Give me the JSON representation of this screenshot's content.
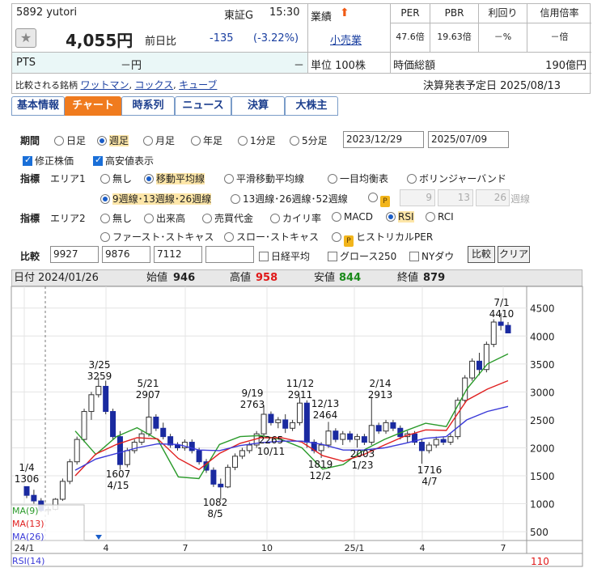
{
  "stock": {
    "code_name": "5892 yutori",
    "market": "東証G",
    "time": "15:30",
    "price": "4,055円",
    "prev_label": "前日比",
    "change": "-135",
    "change_pct": "(-3.22%)",
    "pts_label": "PTS",
    "pts_value": "－円",
    "pts_change": "－",
    "gyoseki_label": "業績",
    "sector": "小売業",
    "unit": "単位 100株",
    "compare_label": "比較される銘柄",
    "compare_list": [
      "ワットマン",
      "コックス",
      "キューブ"
    ],
    "settlement": "決算発表予定日 2025/08/13"
  },
  "metrics": {
    "headers": [
      "PER",
      "PBR",
      "利回り",
      "信用倍率"
    ],
    "values": [
      "47.6倍",
      "19.63倍",
      "－%",
      "－倍"
    ],
    "mcap_label": "時価総額",
    "mcap_value": "190億円"
  },
  "tabs": [
    "基本情報",
    "チャート",
    "時系列",
    "ニュース",
    "決算",
    "大株主"
  ],
  "controls": {
    "period_label": "期間",
    "period_options": [
      "日足",
      "週足",
      "月足",
      "年足",
      "1分足",
      "5分足"
    ],
    "date_from": "2023/12/29",
    "date_to": "2025/07/09",
    "adjusted_label": "修正株価",
    "highlow_label": "高安値表示",
    "indicator_label": "指標",
    "area1_label": "エリア1",
    "area1_options": [
      "無し",
      "移動平均線",
      "平滑移動平均線",
      "一目均衡表",
      "ボリンジャーバンド"
    ],
    "ma_options": [
      "9週線･13週線･26週線",
      "13週線･26週線･52週線"
    ],
    "ma_custom": [
      "9",
      "13",
      "26"
    ],
    "ma_unit": "週線",
    "area2_label": "エリア2",
    "area2_options": [
      "無し",
      "出来高",
      "売買代金",
      "カイリ率",
      "MACD",
      "RSI",
      "RCI"
    ],
    "area2_row2": [
      "ファースト･ストキャス",
      "スロー･ストキャス",
      "ヒストリカルPER"
    ],
    "compare_label": "比較",
    "compare_codes": [
      "9927",
      "9876",
      "7112",
      ""
    ],
    "compare_checks": [
      "日経平均",
      "グロース250",
      "NYダウ"
    ],
    "compare_btn": "比較",
    "clear_btn": "クリア"
  },
  "infobar": {
    "date_label": "日付",
    "date": "2024/01/26",
    "open_label": "始値",
    "open": "946",
    "high_label": "高値",
    "high": "958",
    "low_label": "安値",
    "low": "844",
    "close_label": "終値",
    "close": "879"
  },
  "chart_data": {
    "type": "candlestick",
    "ylim": [
      400,
      4800
    ],
    "yticks": [
      500,
      1000,
      1500,
      2000,
      2500,
      3000,
      3500,
      4000,
      4500
    ],
    "xticks": [
      "24/1",
      "4",
      "7",
      "10",
      "25/1",
      "4",
      "7"
    ],
    "candles": [
      [
        1306,
        1306,
        1100,
        1150
      ],
      [
        1150,
        1250,
        1000,
        1050
      ],
      [
        1050,
        1100,
        850,
        879
      ],
      [
        879,
        950,
        800,
        900
      ],
      [
        900,
        1100,
        880,
        1080
      ],
      [
        1080,
        1450,
        1050,
        1400
      ],
      [
        1400,
        1800,
        1350,
        1750
      ],
      [
        1750,
        2200,
        1700,
        2150
      ],
      [
        2150,
        2700,
        2100,
        2650
      ],
      [
        2650,
        3000,
        2500,
        2950
      ],
      [
        2950,
        3259,
        2900,
        3100
      ],
      [
        3100,
        3200,
        2600,
        2650
      ],
      [
        2650,
        2700,
        2150,
        2200
      ],
      [
        2200,
        2300,
        1607,
        1700
      ],
      [
        1700,
        2000,
        1650,
        1950
      ],
      [
        1950,
        2150,
        1900,
        2100
      ],
      [
        2100,
        2300,
        2050,
        2250
      ],
      [
        2250,
        2907,
        2200,
        2550
      ],
      [
        2550,
        2600,
        2300,
        2350
      ],
      [
        2350,
        2450,
        2150,
        2200
      ],
      [
        2200,
        2250,
        2000,
        2050
      ],
      [
        2050,
        2100,
        1950,
        2000
      ],
      [
        2000,
        2150,
        1950,
        2100
      ],
      [
        2100,
        2150,
        1900,
        1950
      ],
      [
        1950,
        2000,
        1700,
        1750
      ],
      [
        1750,
        1800,
        1550,
        1600
      ],
      [
        1600,
        1650,
        1300,
        1350
      ],
      [
        1350,
        1450,
        1082,
        1300
      ],
      [
        1300,
        1700,
        1280,
        1650
      ],
      [
        1650,
        1900,
        1600,
        1850
      ],
      [
        1850,
        2000,
        1800,
        1950
      ],
      [
        1950,
        2100,
        1900,
        2050
      ],
      [
        2050,
        2300,
        2000,
        2250
      ],
      [
        2250,
        2763,
        2200,
        2600
      ],
      [
        2600,
        2650,
        2400,
        2450
      ],
      [
        2450,
        2550,
        2350,
        2500
      ],
      [
        2500,
        2600,
        2265,
        2350
      ],
      [
        2350,
        2500,
        2300,
        2450
      ],
      [
        2450,
        2911,
        2400,
        2800
      ],
      [
        2800,
        2850,
        2000,
        2100
      ],
      [
        2100,
        2150,
        1900,
        1950
      ],
      [
        1950,
        2100,
        1819,
        2050
      ],
      [
        2050,
        2464,
        2000,
        2300
      ],
      [
        2300,
        2350,
        2100,
        2150
      ],
      [
        2150,
        2300,
        2050,
        2250
      ],
      [
        2250,
        2300,
        2100,
        2150
      ],
      [
        2150,
        2250,
        2003,
        2200
      ],
      [
        2200,
        2250,
        2050,
        2100
      ],
      [
        2100,
        2913,
        2050,
        2400
      ],
      [
        2400,
        2450,
        2250,
        2300
      ],
      [
        2300,
        2500,
        2250,
        2450
      ],
      [
        2450,
        2500,
        2300,
        2350
      ],
      [
        2350,
        2400,
        2150,
        2200
      ],
      [
        2200,
        2300,
        2100,
        2250
      ],
      [
        2250,
        2300,
        2050,
        2100
      ],
      [
        2100,
        2150,
        1716,
        1950
      ],
      [
        1950,
        2100,
        1900,
        2050
      ],
      [
        2050,
        2200,
        2000,
        2150
      ],
      [
        2150,
        2200,
        2050,
        2100
      ],
      [
        2100,
        2250,
        2050,
        2200
      ],
      [
        2200,
        2900,
        2150,
        2850
      ],
      [
        2850,
        3300,
        2800,
        3250
      ],
      [
        3250,
        3600,
        3200,
        3550
      ],
      [
        3550,
        3700,
        3300,
        3400
      ],
      [
        3400,
        3900,
        3350,
        3850
      ],
      [
        3850,
        4300,
        3800,
        4250
      ],
      [
        4250,
        4410,
        4100,
        4190
      ],
      [
        4190,
        4250,
        4050,
        4055
      ]
    ],
    "ma": [
      {
        "name": "MA(9)",
        "color": "#2a9a2a",
        "values": [
          2300,
          1880,
          2200,
          2360,
          2150,
          1480,
          1450,
          2060,
          2200,
          2220,
          2150,
          2000,
          1620,
          1700,
          1960,
          2150,
          2300,
          2440,
          2380,
          3050,
          3500,
          3680
        ]
      },
      {
        "name": "MA(13)",
        "color": "#e02020",
        "values": [
          1500,
          1890,
          2060,
          2180,
          2160,
          1810,
          1610,
          1900,
          2080,
          2180,
          2180,
          2100,
          1860,
          1760,
          1880,
          2050,
          2210,
          2320,
          2310,
          2850,
          3050,
          3200
        ]
      },
      {
        "name": "MA(26)",
        "color": "#3a3ad8",
        "values": [
          1600,
          1800,
          1900,
          2000,
          2070,
          2060,
          1960,
          1950,
          2040,
          2090,
          2120,
          2120,
          2060,
          1960,
          1960,
          2000,
          2080,
          2170,
          2200,
          2500,
          2650,
          2740
        ]
      }
    ],
    "annotations": [
      {
        "label": "1/4",
        "value": "1306"
      },
      {
        "label": "3/25",
        "value": "3259"
      },
      {
        "label": "1607",
        "value": "4/15"
      },
      {
        "label": "5/21",
        "value": "2907"
      },
      {
        "label": "1082",
        "value": "8/5"
      },
      {
        "label": "9/19",
        "value": "2763"
      },
      {
        "label": "2265",
        "value": "10/11"
      },
      {
        "label": "11/12",
        "value": "2911"
      },
      {
        "label": "12/13",
        "value": "2464"
      },
      {
        "label": "1819",
        "value": "12/2"
      },
      {
        "label": "2003",
        "value": "1/23"
      },
      {
        "label": "2/14",
        "value": "2913"
      },
      {
        "label": "1716",
        "value": "4/7"
      },
      {
        "label": "7/1",
        "value": "4410"
      }
    ],
    "rsi_label": "RSI(14)",
    "rsi_top": "110"
  }
}
